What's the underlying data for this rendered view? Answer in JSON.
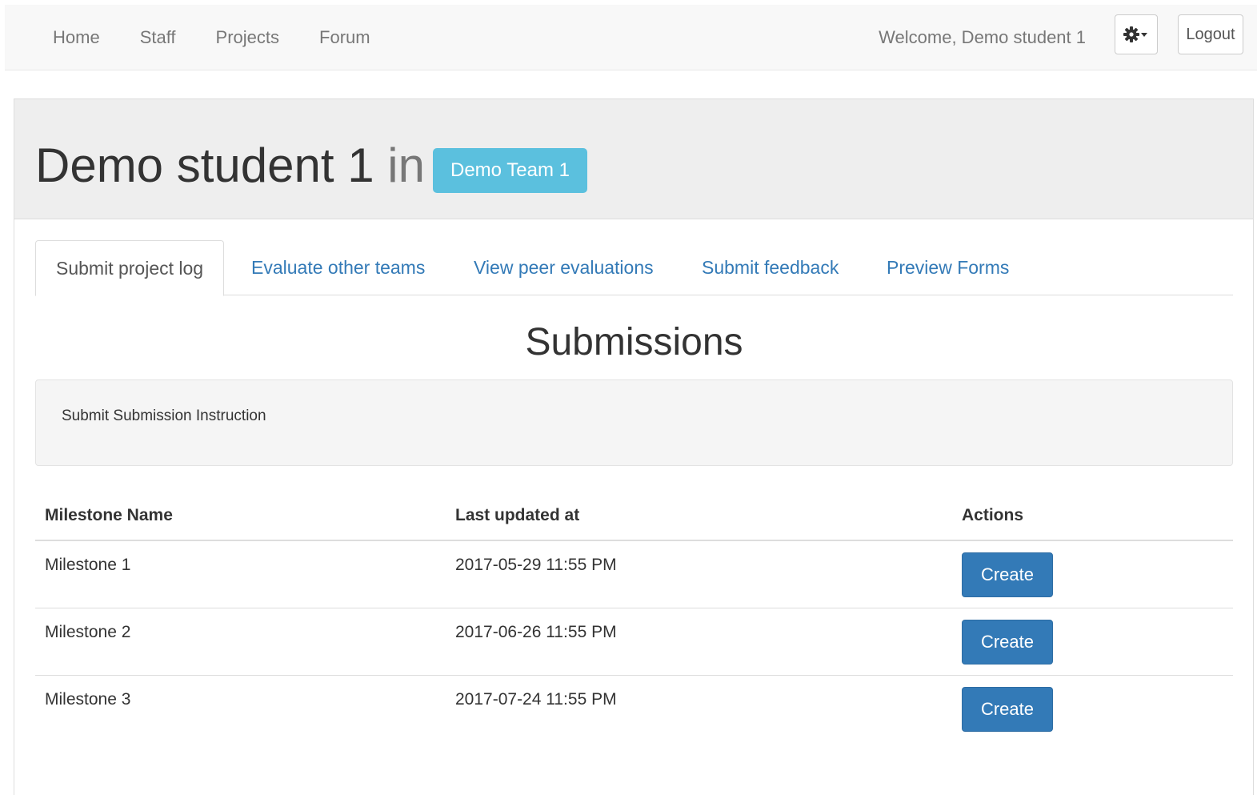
{
  "navbar": {
    "links": [
      {
        "label": "Home"
      },
      {
        "label": "Staff"
      },
      {
        "label": "Projects"
      },
      {
        "label": "Forum"
      }
    ],
    "welcome": "Welcome, Demo student 1",
    "settings_icon": "gear-icon",
    "logout_label": "Logout"
  },
  "header": {
    "student_name": "Demo student 1",
    "in_word": "in",
    "team": "Demo Team 1"
  },
  "tabs": [
    {
      "label": "Submit project log",
      "active": true
    },
    {
      "label": "Evaluate other teams",
      "active": false
    },
    {
      "label": "View peer evaluations",
      "active": false
    },
    {
      "label": "Submit feedback",
      "active": false
    },
    {
      "label": "Preview Forms",
      "active": false
    }
  ],
  "submissions": {
    "title": "Submissions",
    "instruction": "Submit Submission Instruction",
    "table": {
      "headers": [
        "Milestone Name",
        "Last updated at",
        "Actions"
      ],
      "rows": [
        {
          "milestone": "Milestone 1",
          "updated": "2017-05-29 11:55 PM",
          "action": "Create"
        },
        {
          "milestone": "Milestone 2",
          "updated": "2017-06-26 11:55 PM",
          "action": "Create"
        },
        {
          "milestone": "Milestone 3",
          "updated": "2017-07-24 11:55 PM",
          "action": "Create"
        }
      ]
    }
  },
  "colors": {
    "primary": "#337ab7",
    "info": "#5bc0de",
    "navbar_bg": "#f8f8f8",
    "jumbotron_bg": "#eeeeee"
  }
}
